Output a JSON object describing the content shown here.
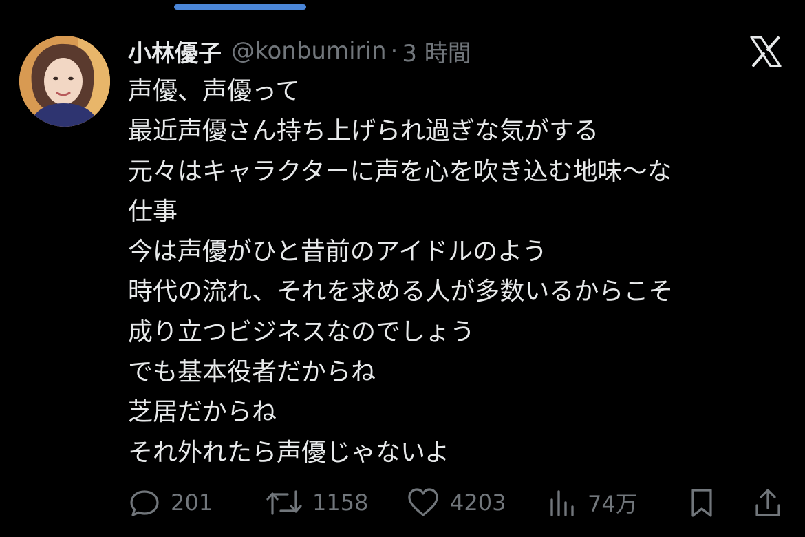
{
  "tweet": {
    "display_name": "小林優子",
    "handle": "@konbumirin",
    "separator": "·",
    "timestamp": "3 時間",
    "lines": [
      "声優、声優って",
      "最近声優さん持ち上げられ過ぎな気がする",
      "元々はキャラクターに声を心を吹き込む地味〜な",
      "仕事",
      "今は声優がひと昔前のアイドルのよう",
      "時代の流れ、それを求める人が多数いるからこそ",
      "成り立つビジネスなのでしょう",
      "でも基本役者だからね",
      "芝居だからね",
      "それ外れたら声優じゃないよ"
    ]
  },
  "actions": {
    "replies": "201",
    "retweets": "1158",
    "likes": "4203",
    "views": "74万"
  },
  "icons": {
    "close": "x-logo-icon",
    "reply": "reply-bubble-icon",
    "retweet": "retweet-icon",
    "like": "heart-icon",
    "views": "bar-chart-icon",
    "bookmark": "bookmark-icon",
    "share": "share-icon"
  },
  "colors": {
    "background": "#000000",
    "text_primary": "#e7e9ea",
    "text_secondary": "#71767b",
    "accent": "#4a86d8"
  }
}
